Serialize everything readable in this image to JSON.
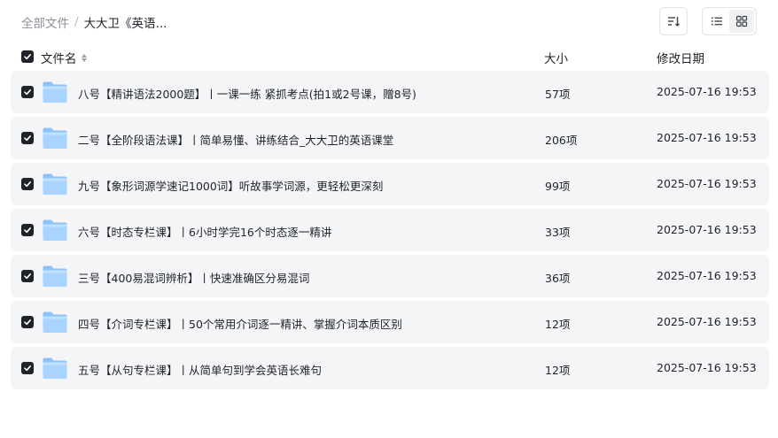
{
  "breadcrumb": {
    "root": "全部文件",
    "separator": "/",
    "current": "大大卫《英语..."
  },
  "toolbar": {
    "sort_icon": "sort-icon",
    "list_view_icon": "list-view-icon",
    "grid_view_icon": "grid-view-icon"
  },
  "table": {
    "columns": {
      "name": "文件名",
      "size": "大小",
      "date": "修改日期"
    },
    "rows": [
      {
        "name": "八号【精讲语法2000题】丨一课一练 紧抓考点(拍1或2号课，赠8号)",
        "size": "57项",
        "date": "2025-07-16 19:53",
        "checked": true
      },
      {
        "name": "二号【全阶段语法课】丨简单易懂、讲练结合_大大卫的英语课堂",
        "size": "206项",
        "date": "2025-07-16 19:53",
        "checked": true
      },
      {
        "name": "九号【象形词源学速记1000词】听故事学词源，更轻松更深刻",
        "size": "99项",
        "date": "2025-07-16 19:53",
        "checked": true
      },
      {
        "name": "六号【时态专栏课】丨6小时学完16个时态逐一精讲",
        "size": "33项",
        "date": "2025-07-16 19:53",
        "checked": true
      },
      {
        "name": "三号【400易混词辨析】丨快速准确区分易混词",
        "size": "36项",
        "date": "2025-07-16 19:53",
        "checked": true
      },
      {
        "name": "四号【介词专栏课】丨50个常用介词逐一精讲、掌握介词本质区别",
        "size": "12项",
        "date": "2025-07-16 19:53",
        "checked": true
      },
      {
        "name": "五号【从句专栏课】丨从简单句到学会英语长难句",
        "size": "12项",
        "date": "2025-07-16 19:53",
        "checked": true
      }
    ]
  },
  "colors": {
    "row_bg": "#f4f5f6",
    "checkbox": "#1f2329",
    "folder_light": "#a9d4ff",
    "folder_dark": "#6fb3f5"
  }
}
